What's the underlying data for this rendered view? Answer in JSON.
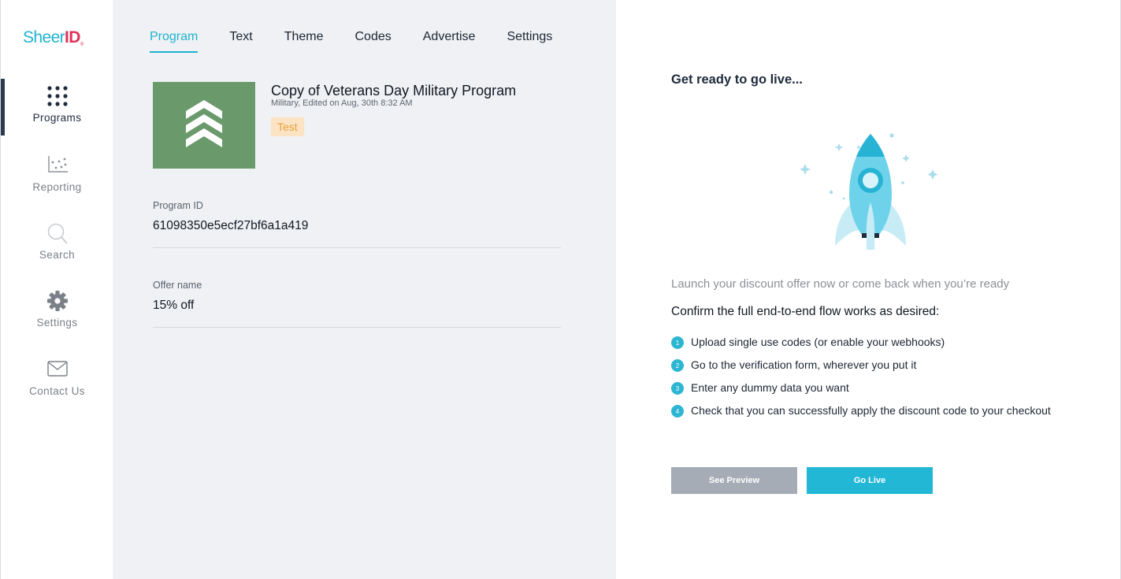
{
  "logo": {
    "sheer": "Sheer",
    "id": "ID",
    "tm": "®"
  },
  "sidebar": {
    "items": [
      {
        "label": "Programs",
        "icon": "grid-icon",
        "active": true
      },
      {
        "label": "Reporting",
        "icon": "scatter-chart-icon",
        "active": false
      },
      {
        "label": "Search",
        "icon": "search-icon",
        "active": false
      },
      {
        "label": "Settings",
        "icon": "gear-icon",
        "active": false
      },
      {
        "label": "Contact Us",
        "icon": "envelope-icon",
        "active": false
      }
    ]
  },
  "tabs": [
    {
      "label": "Program",
      "active": true
    },
    {
      "label": "Text",
      "active": false
    },
    {
      "label": "Theme",
      "active": false
    },
    {
      "label": "Codes",
      "active": false
    },
    {
      "label": "Advertise",
      "active": false
    },
    {
      "label": "Settings",
      "active": false
    }
  ],
  "program": {
    "title": "Copy of Veterans Day Military Program",
    "subtitle": "Military, Edited on Aug, 30th 8:32 AM",
    "badge": "Test",
    "image_icon": "chevron-stack-icon",
    "image_color": "#6a9a6c"
  },
  "fields": {
    "program_id": {
      "label": "Program ID",
      "value": "61098350e5ecf27bf6a1a419"
    },
    "offer_name": {
      "label": "Offer name",
      "value": "15% off"
    }
  },
  "right": {
    "title": "Get ready to go live...",
    "illustration": "rocket-icon",
    "launch_text": "Launch your discount offer now or come back when you’re ready",
    "confirm_text": "Confirm the full end-to-end flow works as desired:",
    "steps": [
      {
        "num": "1",
        "text": "Upload single use codes (or enable your webhooks)"
      },
      {
        "num": "2",
        "text": "Go to the verification form, wherever you put it"
      },
      {
        "num": "3",
        "text": "Enter any dummy data you want"
      },
      {
        "num": "4",
        "text": "Check that you can successfully apply the discount code to your checkout"
      }
    ],
    "buttons": {
      "preview": "See Preview",
      "live": "Go Live"
    }
  },
  "colors": {
    "accent": "#1fb3cf",
    "brand_red": "#e0325b",
    "badge_bg": "#fbe3c4",
    "badge_text": "#eaa03a",
    "preview_button": "#a5acb5",
    "live_button": "#23b7d6"
  }
}
